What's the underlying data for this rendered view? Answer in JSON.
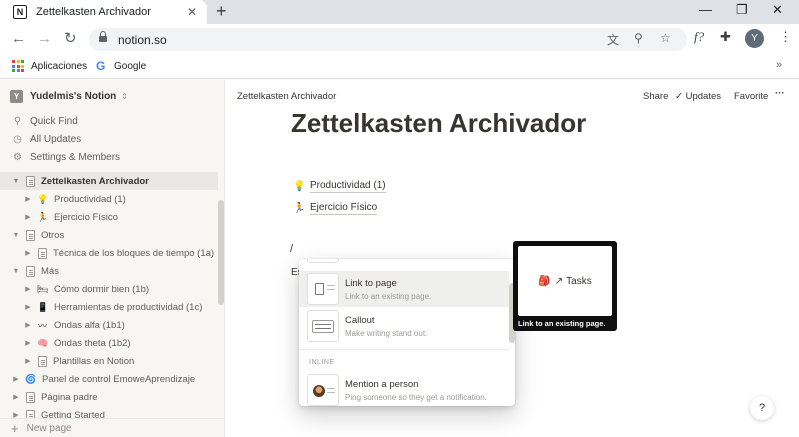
{
  "browser": {
    "tab_title": "Zettelkasten Archivador",
    "favicon": "N",
    "new_tab": "+",
    "close": "✕",
    "url": "notion.so",
    "profile_initial": "Y",
    "bookmarks": {
      "apps_label": "Aplicaciones",
      "google_label": "Google",
      "google_glyph": "G",
      "more": "»"
    },
    "icons": [
      "back-arrow-icon",
      "forward-arrow-icon",
      "reload-icon",
      "lock-icon",
      "translate-icon",
      "zoom-icon",
      "star-icon",
      "function-extension-icon",
      "puzzle-extensions-icon"
    ]
  },
  "sidebar": {
    "workspace_badge": "Y",
    "workspace_name": "Yudelmis's Notion",
    "menu": [
      {
        "label": "Quick Find",
        "icon": "search-icon"
      },
      {
        "label": "All Updates",
        "icon": "clock-icon"
      },
      {
        "label": "Settings & Members",
        "icon": "gear-icon"
      }
    ],
    "tree": [
      {
        "label": "Zettelkasten Archivador",
        "level": 0,
        "expanded": true,
        "icon": "page",
        "selected": true
      },
      {
        "label": "Productividad (1)",
        "level": 1,
        "expanded": false,
        "icon": "💡"
      },
      {
        "label": "Ejercicio Físico",
        "level": 1,
        "expanded": false,
        "icon": "🏃"
      },
      {
        "label": "Otros",
        "level": 0,
        "expanded": true,
        "icon": "page"
      },
      {
        "label": "Técnica de los bloques de tiempo (1a)",
        "level": 1,
        "expanded": false,
        "icon": "page"
      },
      {
        "label": "Más",
        "level": 0,
        "expanded": true,
        "icon": "page"
      },
      {
        "label": "Cómo dormir bien (1b)",
        "level": 1,
        "expanded": false,
        "icon": "🛏"
      },
      {
        "label": "Herramientas de productividad (1c)",
        "level": 1,
        "expanded": false,
        "icon": "📱"
      },
      {
        "label": "Ondas alfa (1b1)",
        "level": 1,
        "expanded": false,
        "icon": "〰"
      },
      {
        "label": "Ondas theta (1b2)",
        "level": 1,
        "expanded": false,
        "icon": "🧠"
      },
      {
        "label": "Plantillas en Notion",
        "level": 1,
        "expanded": false,
        "icon": "page"
      },
      {
        "label": "Panel de control EmoweAprendizaje",
        "level": 0,
        "expanded": false,
        "icon": "🌀"
      },
      {
        "label": "Página padre",
        "level": 0,
        "expanded": false,
        "icon": "page"
      },
      {
        "label": "Getting Started",
        "level": 0,
        "expanded": false,
        "icon": "page"
      }
    ],
    "new_page": "New page"
  },
  "topbar": {
    "breadcrumb": "Zettelkasten Archivador",
    "share": "Share",
    "updates": "Updates",
    "favorite": "Favorite",
    "more": "···"
  },
  "page": {
    "title": "Zettelkasten Archivador",
    "links": [
      {
        "icon": "💡",
        "label": "Productividad (1)"
      },
      {
        "icon": "🏃",
        "label": "Ejercicio Físico"
      }
    ],
    "typed": "/",
    "partial_text": "Es"
  },
  "slash_menu": {
    "items": [
      {
        "title": "Link to page",
        "desc": "Link to an existing page."
      },
      {
        "title": "Callout",
        "desc": "Make writing stand out."
      }
    ],
    "section_inline": "INLINE",
    "mention": {
      "title": "Mention a person",
      "desc": "Ping someone so they get a notification."
    }
  },
  "preview": {
    "bag": "🎒",
    "arrow": "↗",
    "name": "Tasks",
    "caption": "Link to an existing page."
  },
  "help": "?",
  "colors": {
    "sidebar_bg": "#f7f6f3",
    "text": "#37352f",
    "muted": "#9b9a97",
    "chrome": "#dee1e6"
  }
}
